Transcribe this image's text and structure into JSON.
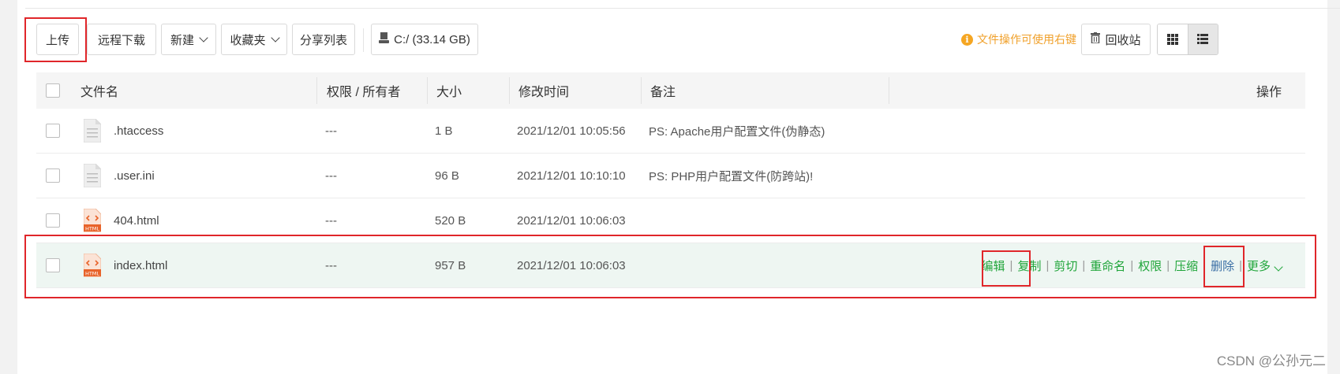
{
  "toolbar": {
    "upload": "上传",
    "remote_download": "远程下载",
    "new": "新建",
    "favorites": "收藏夹",
    "share_list": "分享列表",
    "disk": "C:/ (33.14 GB)",
    "hint": "文件操作可使用右键",
    "recycle_bin": "回收站"
  },
  "table": {
    "headers": {
      "name": "文件名",
      "perm": "权限 / 所有者",
      "size": "大小",
      "mtime": "修改时间",
      "note": "备注",
      "ops": "操作"
    },
    "rows": [
      {
        "name": ".htaccess",
        "perm": "---",
        "size": "1 B",
        "mtime": "2021/12/01 10:05:56",
        "note": "PS: Apache用户配置文件(伪静态)",
        "icon": "text-file-icon"
      },
      {
        "name": ".user.ini",
        "perm": "---",
        "size": "96 B",
        "mtime": "2021/12/01 10:10:10",
        "note": "PS: PHP用户配置文件(防跨站)!",
        "icon": "text-file-icon"
      },
      {
        "name": "404.html",
        "perm": "---",
        "size": "520 B",
        "mtime": "2021/12/01 10:06:03",
        "note": "",
        "icon": "html-file-icon"
      },
      {
        "name": "index.html",
        "perm": "---",
        "size": "957 B",
        "mtime": "2021/12/01 10:06:03",
        "note": "",
        "icon": "html-file-icon"
      }
    ],
    "row_ops": {
      "edit": "编辑",
      "copy": "复制",
      "cut": "剪切",
      "rename": "重命名",
      "permission": "权限",
      "compress": "压缩",
      "delete": "删除",
      "more": "更多",
      "sep": "|"
    }
  },
  "html_badge": "HTML",
  "watermark": "CSDN @公孙元二",
  "colors": {
    "accent_green": "#20a53a",
    "hint_orange": "#f0a02a",
    "annotation_red": "#e0262a",
    "highlight_row": "#eef6f2"
  }
}
